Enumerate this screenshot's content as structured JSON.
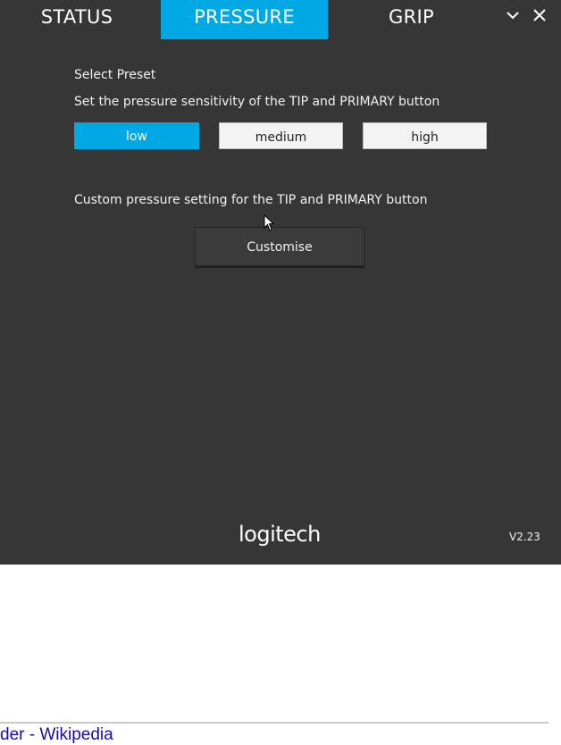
{
  "tabs": [
    {
      "label": "STATUS",
      "active": false
    },
    {
      "label": "PRESSURE",
      "active": true
    },
    {
      "label": "GRIP",
      "active": false
    }
  ],
  "window_controls": {
    "minimize_icon": "chevron-down-icon",
    "close_icon": "close-icon"
  },
  "pressure": {
    "select_preset_label": "Select Preset",
    "sensitivity_description": "Set the pressure sensitivity of the TIP and PRIMARY button",
    "presets": [
      {
        "label": "low",
        "selected": true
      },
      {
        "label": "medium",
        "selected": false
      },
      {
        "label": "high",
        "selected": false
      }
    ],
    "custom_description": "Custom pressure setting for the TIP and PRIMARY button",
    "customise_label": "Customise"
  },
  "footer": {
    "brand": "logitech",
    "version": "V2.23"
  },
  "background_page": {
    "link_text_partial": "der - Wikipedia"
  },
  "colors": {
    "accent": "#00a8e4",
    "panel_bg": "#363636",
    "link": "#1a0dab"
  }
}
